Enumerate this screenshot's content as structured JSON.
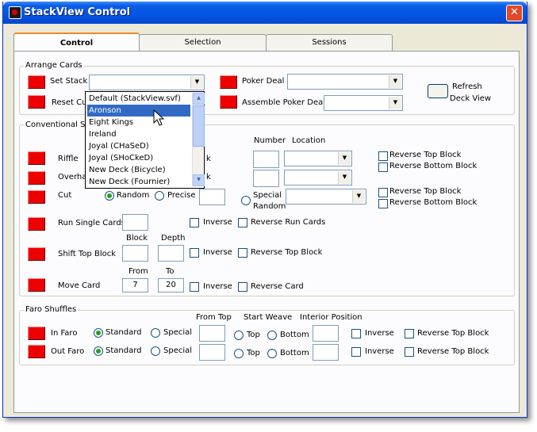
{
  "window": {
    "title": "StackView Control"
  },
  "tabs": [
    {
      "label": "Control"
    },
    {
      "label": "Selection"
    },
    {
      "label": "Sessions"
    }
  ],
  "arrange": {
    "legend": "Arrange Cards",
    "set_stack": "Set Stack",
    "reset_cum": "Reset Cum",
    "poker_deal": "Poker Deal",
    "assemble_poker_deal": "Assemble Poker Deal",
    "refresh_line1": "Refresh",
    "refresh_line2": "Deck View"
  },
  "stack_options": [
    "Default (StackView.svf)",
    "Aronson",
    "Eight Kings",
    "Ireland",
    "Joyal (CHaSeD)",
    "Joyal (SHoCkeD)",
    "New Deck (Bicycle)",
    "New Deck (Fournier)"
  ],
  "conventional": {
    "legend": "Conventional Shuffl",
    "riffle": "Riffle",
    "overhand": "Overhan",
    "k1": "k",
    "k2": "k",
    "number_header": "Number",
    "location_header": "Location",
    "reverse_top_block": "Reverse Top Block",
    "reverse_bottom_block": "Reverse Bottom Block",
    "cut": "Cut",
    "random": "Random",
    "precise": "Precise",
    "special": "Special",
    "random2": "Random",
    "run_single_cards": "Run Single Cards",
    "inverse": "Inverse",
    "reverse_run_cards": "Reverse Run Cards",
    "block_header": "Block",
    "depth_header": "Depth",
    "shift_top_block": "Shift Top Block",
    "from_header": "From",
    "to_header": "To",
    "move_card": "Move Card",
    "from_value": "7",
    "to_value": "20",
    "reverse_card": "Reverse Card"
  },
  "faro": {
    "legend": "Faro Shuffles",
    "from_top": "From Top",
    "start_weave": "Start Weave",
    "interior_position": "Interior Position",
    "in_faro": "In Faro",
    "out_faro": "Out Faro",
    "standard": "Standard",
    "special": "Special",
    "top": "Top",
    "bottom": "Bottom",
    "inverse": "Inverse",
    "reverse_top_block": "Reverse Top Block"
  },
  "icons": {
    "arrow": "▼",
    "close": "✕",
    "scroll_up": "▲",
    "scroll_down": "▼"
  },
  "colors": {
    "action_button": "#ee0000",
    "titlebar": "#0454e2",
    "selection": "#316ac5"
  }
}
